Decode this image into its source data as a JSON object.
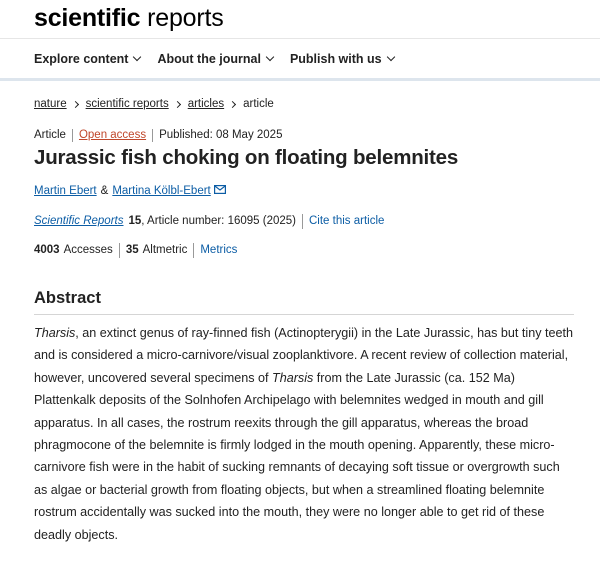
{
  "logo": {
    "bold": "scientific",
    "light": "reports"
  },
  "nav": {
    "items": [
      {
        "label": "Explore content"
      },
      {
        "label": "About the journal"
      },
      {
        "label": "Publish with us"
      }
    ]
  },
  "breadcrumb": {
    "items": [
      "nature",
      "scientific reports",
      "articles"
    ],
    "current": "article"
  },
  "article": {
    "type": "Article",
    "access": "Open access",
    "published": "Published: 08 May 2025",
    "title": "Jurassic fish choking on floating belemnites",
    "authors": [
      "Martin Ebert",
      "Martina Kölbl-Ebert"
    ],
    "author_separator": "&",
    "journal": "Scientific Reports",
    "volume": "15",
    "article_number": ", Article number: 16095 (2025)",
    "cite_label": "Cite this article",
    "accesses_count": "4003",
    "accesses_label": "Accesses",
    "altmetric_count": "35",
    "altmetric_label": "Altmetric",
    "metrics_label": "Metrics"
  },
  "abstract": {
    "heading": "Abstract",
    "genus": "Tharsis",
    "part1": ", an extinct genus of ray-finned fish (Actinopterygii) in the Late Jurassic, has but tiny teeth and is considered a micro-carnivore/visual zooplanktivore. A recent review of collection material, however, uncovered several specimens of ",
    "genus2": "Tharsis",
    "part2": " from the Late Jurassic (ca. 152 Ma) Plattenkalk deposits of the Solnhofen Archipelago with belemnites wedged in mouth and gill apparatus. In all cases, the rostrum reexits through the gill apparatus, whereas the broad phragmocone of the belemnite is firmly lodged in the mouth opening. Apparently, these micro-carnivore fish were in the habit of sucking remnants of decaying soft tissue or overgrowth such as algae or bacterial growth from floating objects, but when a streamlined floating belemnite rostrum accidentally was sucked into the mouth, they were no longer able to get rid of these deadly objects."
  }
}
